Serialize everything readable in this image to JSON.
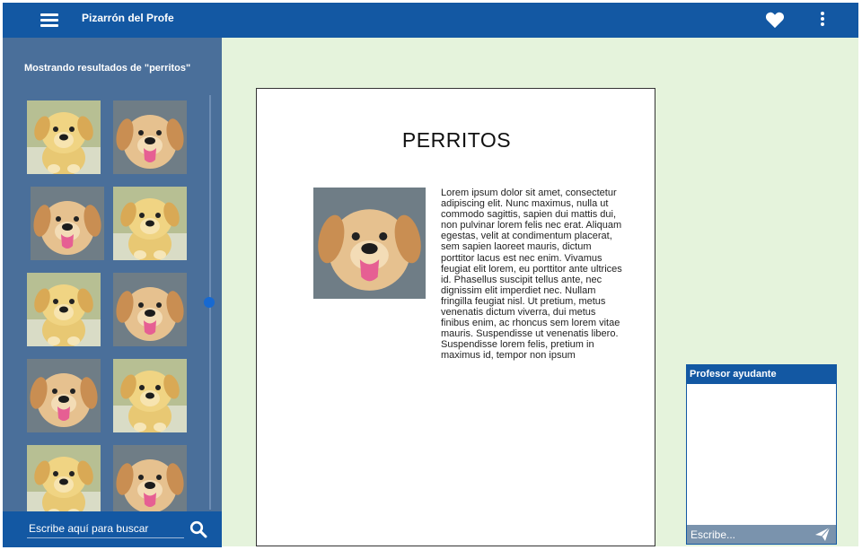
{
  "app": {
    "title": "Pizarrón del Profe",
    "accent_color": "#1358a3",
    "sidebar_color": "#4a6f9a",
    "workspace_color": "#e5f3dc"
  },
  "header": {
    "menu_icon": "hamburger-menu-icon",
    "favorite_icon": "heart-icon",
    "more_icon": "more-vertical-icon"
  },
  "sidebar": {
    "results_title": "Mostrando resultados de \"perritos\"",
    "thumbnails": [
      {
        "alt": "golden puppy"
      },
      {
        "alt": "puppy tongue out"
      },
      {
        "alt": "puppy tongue out"
      },
      {
        "alt": "golden puppy"
      },
      {
        "alt": "golden puppy"
      },
      {
        "alt": "puppy tongue out"
      },
      {
        "alt": "puppy tongue out"
      },
      {
        "alt": "golden puppy"
      },
      {
        "alt": "golden puppy"
      },
      {
        "alt": "puppy tongue out"
      }
    ]
  },
  "search": {
    "placeholder": "Escribe aquí para buscar",
    "value": "",
    "icon": "search-icon"
  },
  "document": {
    "title": "PERRITOS",
    "body": "Lorem ipsum dolor sit amet, consectetur adipiscing elit. Nunc maximus, nulla ut commodo sagittis, sapien dui mattis dui, non pulvinar lorem felis nec erat. Aliquam egestas, velit at condimentum placerat, sem sapien laoreet mauris, dictum porttitor lacus est nec enim. Vivamus feugiat elit lorem, eu porttitor ante ultrices id. Phasellus suscipit tellus ante, nec dignissim elit imperdiet nec. Nullam fringilla feugiat nisl. Ut pretium, metus venenatis dictum viverra, dui metus finibus enim, ac rhoncus sem lorem vitae mauris. Suspendisse ut venenatis libero. Suspendisse lorem felis, pretium in maximus id, tempor non ipsum"
  },
  "helper": {
    "title": "Profesor ayudante",
    "input_placeholder": "Escribe...",
    "input_value": "",
    "send_icon": "send-icon"
  }
}
